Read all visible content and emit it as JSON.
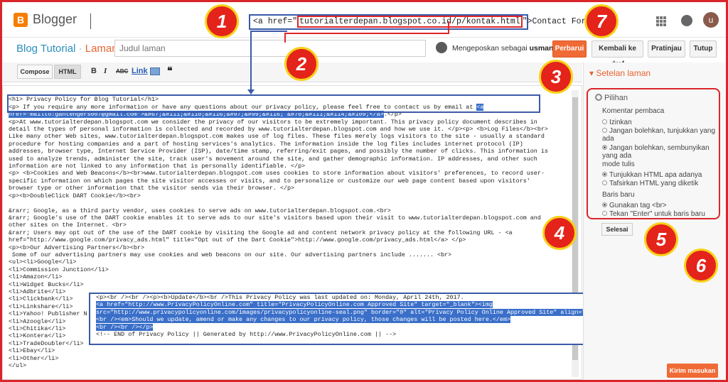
{
  "topbar": {
    "app_name": "Blogger",
    "logo_letter": "B",
    "href_prefix": "<a href=\"",
    "href_url": "tutorialterdepan.blogspot.co.id/p/kontak.html",
    "href_suffix": "\">Contact Form</a>",
    "avatar_letter": "u"
  },
  "titlerow": {
    "blog_name": "Blog Tutorial",
    "separator": "·",
    "section": "Laman",
    "title_placeholder": "Judul laman",
    "poster_prefix": "Mengeposkan sebagai",
    "poster_name": "usman mr",
    "publish_label": "Perbarui",
    "revert_label": "Kembali ke draf",
    "preview_label": "Pratinjau",
    "close_label": "Tutup"
  },
  "toolbar": {
    "compose_label": "Compose",
    "html_label": "HTML",
    "bold": "B",
    "italic": "I",
    "strike": "ABC",
    "link": "Link",
    "quote": "❝"
  },
  "editor": {
    "lines": [
      "",
      "<h1> Privacy Policy for Blog Tutorial</h1>",
      "<p> If you require any more information or have any questions about our privacy policy, please feel free to contact us by email at <a",
      "href=\"mailto:gantengers007@gmail.com\">&#67;&#111;&#110;&#116;&#97;&#99;&#116; &#70;&#111;&#114;&#109;</a>.</p>",
      "<p>At www.tutorialterdepan.blogspot.com we consider the privacy of our visitors to be extremely important. This privacy policy document describes in",
      "detail the types of personal information is collected and recorded by www.tutorialterdepan.blogspot.com and how we use it. </p><p> <b>Log Files</b><br>",
      "Like many other Web sites, www.tutorialterdepan.blogspot.com makes use of log files. These files merely logs visitors to the site - usually a standard",
      "procedure for hosting companies and a part of hosting services's analytics. The information inside the log files includes internet protocol (IP)",
      "addresses, browser type, Internet Service Provider (ISP), date/time stamp, referring/exit pages, and possibly the number of clicks. This information is",
      "used to analyze trends, administer the site, track user's movement around the site, and gather demographic information. IP addresses, and other such",
      "information are not linked to any information that is personally identifiable. </p>",
      "<p> <b>Cookies and Web Beacons</b><br>www.tutorialterdepan.blogspot.com uses cookies to store information about visitors' preferences, to record user-",
      "specific information on which pages the site visitor accesses or visits, and to personalize or customize our web page content based upon visitors'",
      "browser type or other information that the visitor sends via their browser. </p>",
      "<p><b>DoubleClick DART Cookie</b><br>",
      "",
      "&rarr; Google, as a third party vendor, uses cookies to serve ads on www.tutorialterdepan.blogspot.com.<br>",
      "&rarr; Google's use of the DART cookie enables it to serve ads to our site's visitors based upon their visit to www.tutorialterdepan.blogspot.com and",
      "other sites on the Internet. <br>",
      "&rarr; Users may opt out of the use of the DART cookie by visiting the Google ad and content network privacy policy at the following URL - <a",
      "href=\"http://www.google.com/privacy_ads.html\" title=\"Opt out of the Dart Cookie\">http://www.google.com/privacy_ads.html</a> </p>",
      "<p><b>Our Advertising Partners</b><br>",
      " Some of our advertising partners may use cookies and web beacons on our site. Our advertising partners include ....... <br>",
      "<ul><li>Google</li>",
      "<li>Commission Junction</li>",
      "<li>Amazon</li>",
      "<li>Widget Bucks</li>",
      "<li>Adbrite</li>",
      "<li>Clickbank</li>",
      "<li>Linkshare</li>",
      "<li>Yahoo! Publisher N",
      "<li>Azoogle</li>",
      "<li>Chitika</li>",
      "<li>Kontera</li>",
      "<li>TradeDoubler</li>",
      "<li>Ebay</li>",
      "<li>Other</li>",
      "</ul>"
    ]
  },
  "popup": {
    "line0": "<p><br /><br /><p><b>Update</b><br />This Privacy Policy was last updated on: Monday, April 24th, 2017.",
    "line1": "<a href=\"http://www.PrivacyPolicyOnline.com\" title=\"PrivacyPolicyOnline.com Approved Site\" target=\"_blank\"><img",
    "line2": "src=\"http://www.privacypolicyonline.com/images/privacypolicyonline-seal.png\" border=\"0\" alt=\"Privacy Policy Online Approved Site\" align=\"right\" /></a>",
    "line3": "<br /><em>Should we update, amend or make any changes to our privacy policy, those changes will be posted here.</em>",
    "line4": "<br /><br /></p>",
    "line5": "<!-- END of Privacy Policy || Generated by http://www.PrivacyPolicyOnline.com || -->"
  },
  "settings": {
    "panel_title": "Setelan laman",
    "options_heading": "Pilihan",
    "comments_label": "Komentar pembaca",
    "comments_allow": "Izinkan",
    "comments_block_show": "Jangan bolehkan, tunjukkan yang ada",
    "comments_block_hide": "Jangan bolehkan, sembunyikan yang ada",
    "write_mode_label": "mode tulis",
    "write_mode_literal": "Tunjukkan HTML apa adanya",
    "write_mode_interpret": "Tafsirkan HTML yang diketik",
    "newline_label": "Baris baru",
    "newline_br": "Gunakan tag <br>",
    "newline_enter": "Tekan \"Enter\" untuk baris baru",
    "done_label": "Selesai"
  },
  "feedback_label": "Kirim masukan",
  "badges": [
    "1",
    "2",
    "3",
    "4",
    "5",
    "6",
    "7"
  ],
  "colors": {
    "accent": "#f06a35",
    "annotation_blue": "#3b5aa8",
    "annotation_red": "#e0252b",
    "link_blue": "#2a8fbd"
  }
}
